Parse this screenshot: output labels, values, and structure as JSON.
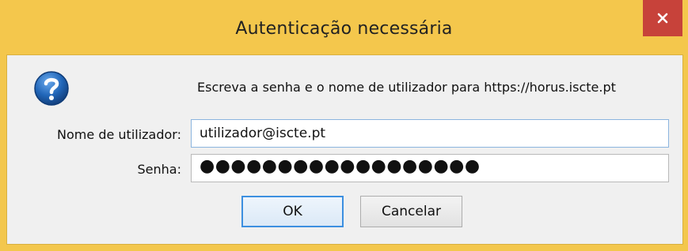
{
  "window": {
    "title": "Autenticação necessária",
    "close_icon": "close-icon"
  },
  "dialog": {
    "icon": "question-icon",
    "message": "Escreva a senha e o nome de utilizador para https://horus.iscte.pt",
    "username_label": "Nome de utilizador:",
    "username_value": "utilizador@iscte.pt",
    "password_label": "Senha:",
    "password_value": "●●●●●●●●●●●●●●●●●●",
    "ok_label": "OK",
    "cancel_label": "Cancelar"
  },
  "colors": {
    "titlebar": "#f4c74c",
    "close_button": "#c7423a",
    "focus_border": "#3c8fe0",
    "question_icon": "#2166b8"
  }
}
